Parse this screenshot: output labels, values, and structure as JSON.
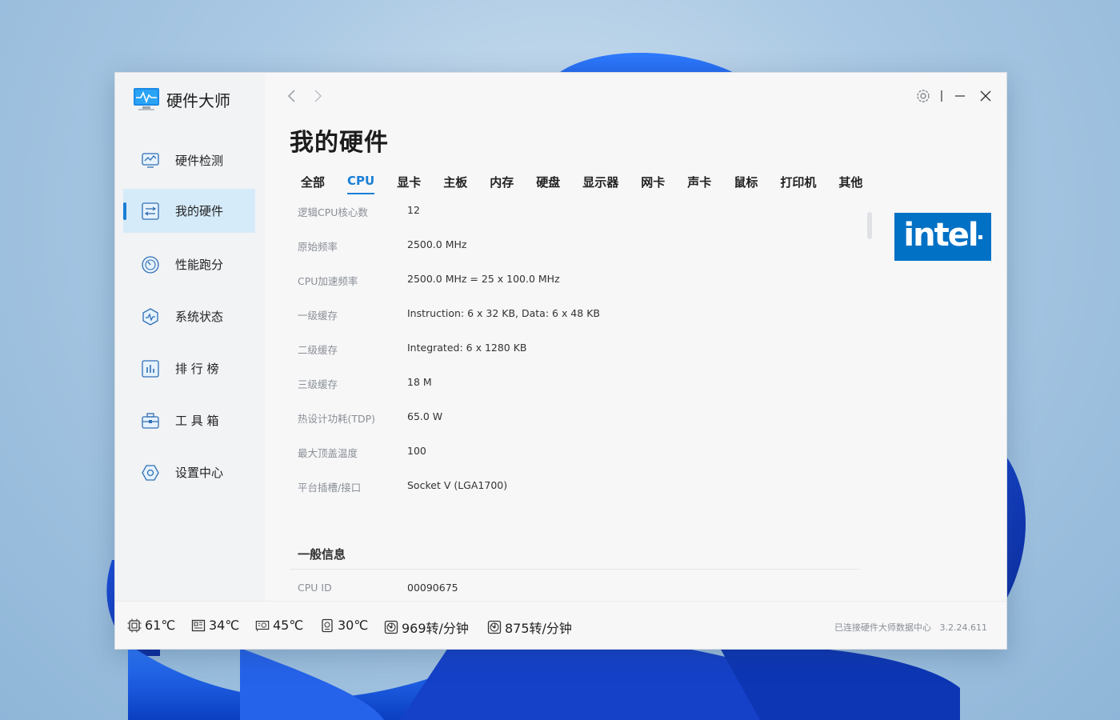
{
  "app": {
    "title": "硬件大师"
  },
  "sidebar": {
    "items": [
      {
        "label": "硬件检测",
        "icon": "chart-monitor-icon"
      },
      {
        "label": "我的硬件",
        "icon": "hardware-list-icon",
        "active": true
      },
      {
        "label": "性能跑分",
        "icon": "speedometer-icon"
      },
      {
        "label": "系统状态",
        "icon": "pulse-hexagon-icon"
      },
      {
        "label": "排 行 榜",
        "icon": "bar-chart-icon"
      },
      {
        "label": "工 具 箱",
        "icon": "toolbox-icon"
      },
      {
        "label": "设置中心",
        "icon": "settings-hexagon-icon"
      }
    ]
  },
  "page": {
    "title": "我的硬件"
  },
  "tabs": [
    "全部",
    "CPU",
    "显卡",
    "主板",
    "内存",
    "硬盘",
    "显示器",
    "网卡",
    "声卡",
    "鼠标",
    "打印机",
    "其他"
  ],
  "active_tab": "CPU",
  "specs": [
    {
      "key": "逻辑CPU核心数",
      "value": "12"
    },
    {
      "key": "原始频率",
      "value": "2500.0 MHz"
    },
    {
      "key": "CPU加速频率",
      "value": "2500.0 MHz = 25 x 100.0 MHz"
    },
    {
      "key": "一级缓存",
      "value": "Instruction: 6 x 32 KB, Data: 6 x 48 KB"
    },
    {
      "key": "二级缓存",
      "value": "Integrated: 6 x 1280 KB"
    },
    {
      "key": "三级缓存",
      "value": "18 M"
    },
    {
      "key": "热设计功耗(TDP)",
      "value": "65.0 W"
    },
    {
      "key": "最大顶盖温度",
      "value": "100"
    },
    {
      "key": "平台插槽/接口",
      "value": "Socket V (LGA1700)"
    }
  ],
  "general": {
    "title": "一般信息",
    "rows": [
      {
        "key": "CPU ID",
        "value": "00090675"
      }
    ]
  },
  "brand": {
    "name": "intel",
    "color": "#0071c5"
  },
  "status": [
    {
      "icon": "cpu-chip-icon",
      "value": "61℃"
    },
    {
      "icon": "motherboard-icon",
      "value": "34℃"
    },
    {
      "icon": "gpu-card-icon",
      "value": "45℃"
    },
    {
      "icon": "disk-drive-icon",
      "value": "30℃"
    },
    {
      "icon": "fan-icon",
      "value": "969转/分钟"
    },
    {
      "icon": "fan-icon",
      "value": "875转/分钟"
    }
  ],
  "footer": {
    "connection": "已连接硬件大师数据中心",
    "version": "3.2.24.611"
  },
  "colors": {
    "accent": "#1a7fd6",
    "active_bg": "#d6ebfa"
  }
}
